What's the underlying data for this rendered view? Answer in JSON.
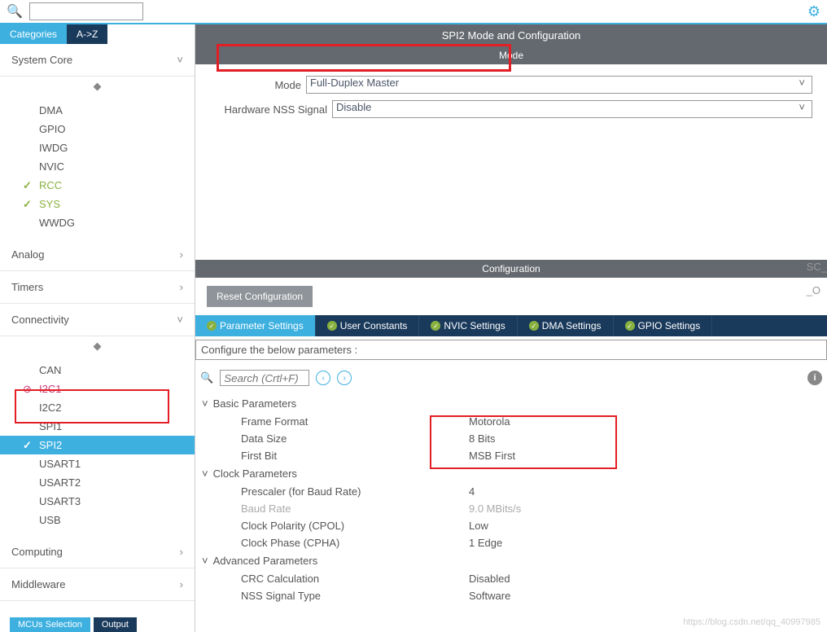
{
  "top": {
    "search_placeholder": ""
  },
  "tabs": {
    "categories": "Categories",
    "a_z": "A->Z"
  },
  "sidebar": {
    "system_core": {
      "label": "System Core",
      "items": [
        "DMA",
        "GPIO",
        "IWDG",
        "NVIC",
        "RCC",
        "SYS",
        "WWDG"
      ]
    },
    "analog": {
      "label": "Analog"
    },
    "timers": {
      "label": "Timers"
    },
    "connectivity": {
      "label": "Connectivity",
      "items": [
        "CAN",
        "I2C1",
        "I2C2",
        "SPI1",
        "SPI2",
        "USART1",
        "USART2",
        "USART3",
        "USB"
      ]
    },
    "computing": {
      "label": "Computing"
    },
    "middleware": {
      "label": "Middleware"
    }
  },
  "content": {
    "title": "SPI2 Mode and Configuration",
    "mode_section": "Mode",
    "mode_label": "Mode",
    "mode_value": "Full-Duplex Master",
    "nss_label": "Hardware NSS Signal",
    "nss_value": "Disable",
    "config_section": "Configuration",
    "reset_btn": "Reset Configuration",
    "tabs": [
      "Parameter Settings",
      "User Constants",
      "NVIC Settings",
      "DMA Settings",
      "GPIO Settings"
    ],
    "configure_note": "Configure the below parameters :",
    "search_placeholder": "Search (Crtl+F)",
    "groups": {
      "basic": {
        "label": "Basic Parameters",
        "rows": [
          {
            "label": "Frame Format",
            "value": "Motorola"
          },
          {
            "label": "Data Size",
            "value": "8 Bits"
          },
          {
            "label": "First Bit",
            "value": "MSB First"
          }
        ]
      },
      "clock": {
        "label": "Clock Parameters",
        "rows": [
          {
            "label": "Prescaler (for Baud Rate)",
            "value": "4"
          },
          {
            "label": "Baud Rate",
            "value": "9.0 MBits/s"
          },
          {
            "label": "Clock Polarity (CPOL)",
            "value": "Low"
          },
          {
            "label": "Clock Phase (CPHA)",
            "value": "1 Edge"
          }
        ]
      },
      "advanced": {
        "label": "Advanced Parameters",
        "rows": [
          {
            "label": "CRC Calculation",
            "value": "Disabled"
          },
          {
            "label": "NSS Signal Type",
            "value": "Software"
          }
        ]
      }
    }
  },
  "bottom": {
    "t1": "MCUs Selection",
    "t2": "Output"
  },
  "clip": {
    "c1": "SC_",
    "c2": "_O"
  },
  "watermark": "https://blog.csdn.net/qq_40997985"
}
